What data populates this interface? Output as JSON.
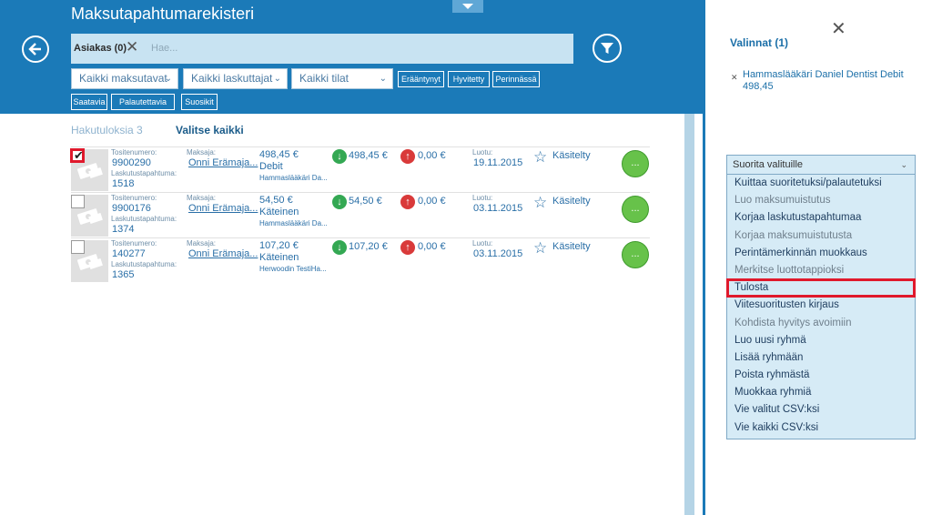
{
  "header": {
    "title": "Maksutapahtumarekisteri",
    "search": {
      "chip_label": "Asiakas (0)",
      "placeholder": "Hae..."
    },
    "dropdowns": [
      "Kaikki maksutavat",
      "Kaikki laskuttajat",
      "Kaikki tilat"
    ],
    "filter_buttons_row1": [
      "Erääntynyt",
      "Hyvitetty",
      "Perinnässä"
    ],
    "filter_buttons_row2": [
      "Saatavia",
      "Palautettavia",
      "Suosikit"
    ]
  },
  "results": {
    "count_label": "Hakutuloksia 3",
    "select_all": "Valitse kaikki",
    "labels": {
      "receipt": "Tositenumero:",
      "invoice_event": "Laskutustapahtuma:",
      "payer": "Maksaja:",
      "created": "Luotu:"
    },
    "rows": [
      {
        "checked": true,
        "receipt": "9900290",
        "invoice_event": "1518",
        "payer": "Onni Erämaja...",
        "amount": "498,45 €",
        "method": "Debit",
        "biller": "Hammaslääkäri Da...",
        "in_amount": "498,45 €",
        "out_amount": "0,00 €",
        "created": "19.11.2015",
        "status": "Käsitelty"
      },
      {
        "checked": false,
        "receipt": "9900176",
        "invoice_event": "1374",
        "payer": "Onni Erämaja...",
        "amount": "54,50 €",
        "method": "Käteinen",
        "biller": "Hammaslääkäri Da...",
        "in_amount": "54,50 €",
        "out_amount": "0,00 €",
        "created": "03.11.2015",
        "status": "Käsitelty"
      },
      {
        "checked": false,
        "receipt": "140277",
        "invoice_event": "1365",
        "payer": "Onni Erämaja...",
        "amount": "107,20 €",
        "method": "Käteinen",
        "biller": "Herwoodin TestiHa...",
        "in_amount": "107,20 €",
        "out_amount": "0,00 €",
        "created": "03.11.2015",
        "status": "Käsitelty"
      }
    ],
    "more_glyph": "..."
  },
  "panel": {
    "selections_title": "Valinnat (1)",
    "selected_item": "Hammaslääkäri Daniel Dentist Debit 498,45",
    "action_dropdown": "Suorita valituille",
    "actions": [
      {
        "label": "Kuittaa suoritetuksi/palautetuksi",
        "enabled": true
      },
      {
        "label": "Luo maksumuistutus",
        "enabled": false
      },
      {
        "label": "Korjaa laskutustapahtumaa",
        "enabled": true
      },
      {
        "label": "Korjaa maksumuistutusta",
        "enabled": false
      },
      {
        "label": "Perintämerkinnän muokkaus",
        "enabled": true
      },
      {
        "label": "Merkitse luottotappioksi",
        "enabled": false
      },
      {
        "label": "Tulosta",
        "enabled": true,
        "highlighted": true
      },
      {
        "label": "Viitesuoritusten kirjaus",
        "enabled": true
      },
      {
        "label": "Kohdista hyvitys avoimiin",
        "enabled": false
      },
      {
        "label": "Luo uusi ryhmä",
        "enabled": true
      },
      {
        "label": "Lisää ryhmään",
        "enabled": true
      },
      {
        "label": "Poista ryhmästä",
        "enabled": true
      },
      {
        "label": "Muokkaa ryhmiä",
        "enabled": true
      },
      {
        "label": "Vie valitut CSV:ksi",
        "enabled": true
      },
      {
        "label": "Vie kaikki CSV:ksi",
        "enabled": true
      }
    ]
  },
  "colors": {
    "header_bg": "#1b7ab8",
    "accent": "#1b6fa8",
    "highlight": "#e0192c",
    "menu_bg": "#d6ebf6"
  }
}
